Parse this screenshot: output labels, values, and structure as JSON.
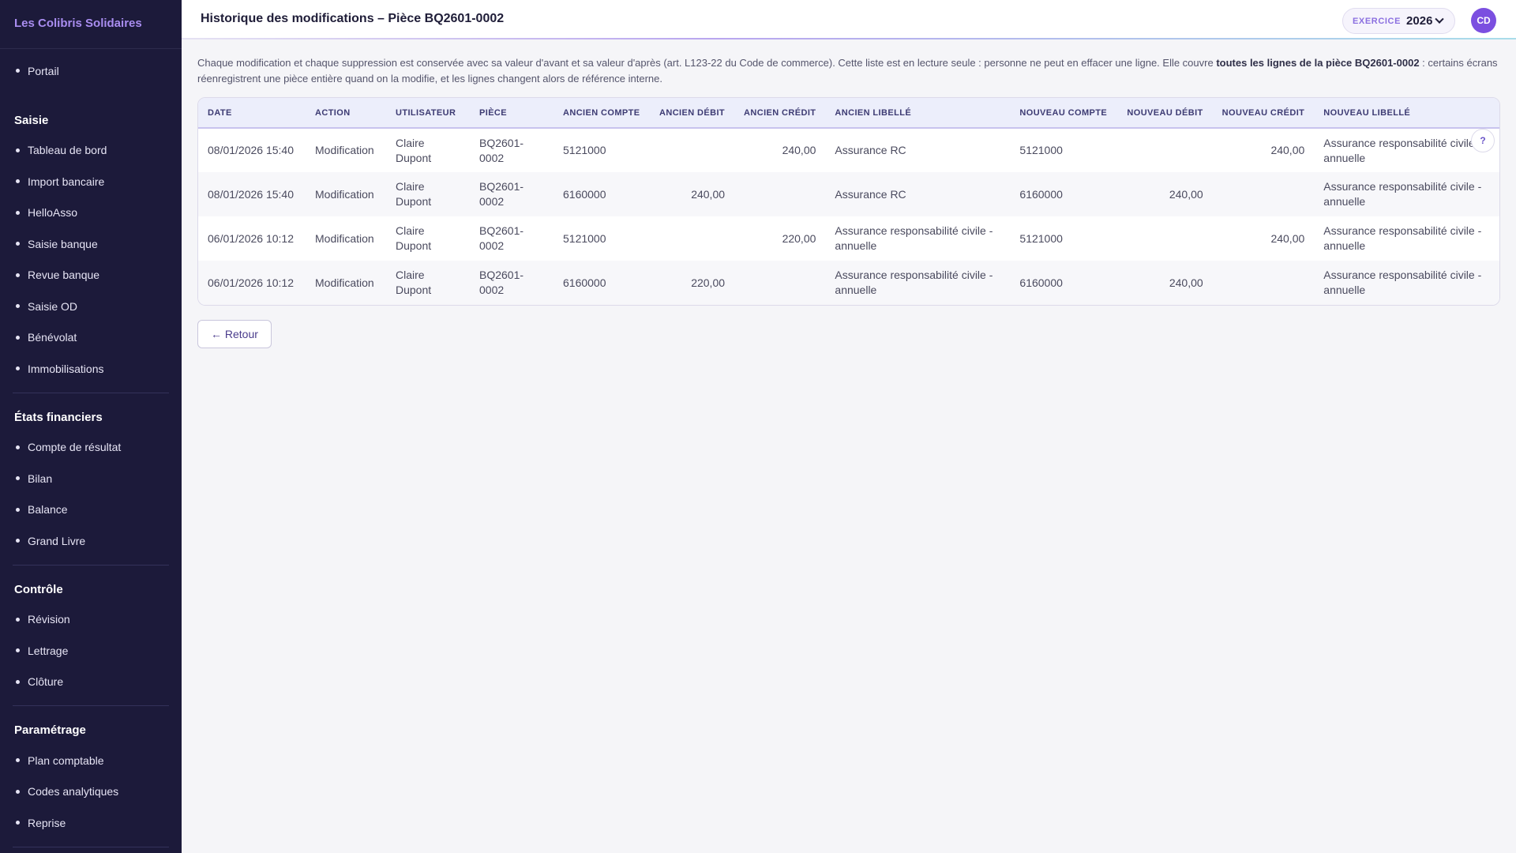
{
  "brand": "Les Colibris Solidaires",
  "nav_top": [
    {
      "label": "Portail"
    }
  ],
  "nav_sections": [
    {
      "title": "Saisie",
      "items": [
        "Tableau de bord",
        "Import bancaire",
        "HelloAsso",
        "Saisie banque",
        "Revue banque",
        "Saisie OD",
        "Bénévolat",
        "Immobilisations"
      ]
    },
    {
      "title": "États financiers",
      "items": [
        "Compte de résultat",
        "Bilan",
        "Balance",
        "Grand Livre"
      ]
    },
    {
      "title": "Contrôle",
      "items": [
        "Révision",
        "Lettrage",
        "Clôture"
      ]
    },
    {
      "title": "Paramétrage",
      "items": [
        "Plan comptable",
        "Codes analytiques",
        "Reprise"
      ]
    }
  ],
  "header": {
    "title": "Historique des modifications – Pièce BQ2601-0002",
    "exercice_label": "EXERCICE",
    "exercice_year": "2026",
    "avatar_initials": "CD"
  },
  "intro": {
    "text": "Chaque modification et chaque suppression est conservée avec sa valeur d'avant et sa valeur d'après (art. L123-22 du Code de commerce). Cette liste est en lecture seule : personne ne peut en effacer une ligne. Elle couvre ",
    "bold": "toutes les lignes de la pièce BQ2601-0002",
    "text_after": " : certains écrans réenregistrent une pièce entière quand on la modifie, et les lignes changent alors de référence interne."
  },
  "table": {
    "columns": [
      "DATE",
      "ACTION",
      "UTILISATEUR",
      "PIÈCE",
      "ANCIEN COMPTE",
      "ANCIEN DÉBIT",
      "ANCIEN CRÉDIT",
      "ANCIEN LIBELLÉ",
      "NOUVEAU COMPTE",
      "NOUVEAU DÉBIT",
      "NOUVEAU CRÉDIT",
      "NOUVEAU LIBELLÉ"
    ],
    "rows": [
      [
        "08/01/2026 15:40",
        "Modification",
        "Claire Dupont",
        "BQ2601-0002",
        "5121000",
        "",
        "240,00",
        "Assurance RC",
        "5121000",
        "",
        "240,00",
        "Assurance responsabilité civile - annuelle"
      ],
      [
        "08/01/2026 15:40",
        "Modification",
        "Claire Dupont",
        "BQ2601-0002",
        "6160000",
        "240,00",
        "",
        "Assurance RC",
        "6160000",
        "240,00",
        "",
        "Assurance responsabilité civile - annuelle"
      ],
      [
        "06/01/2026 10:12",
        "Modification",
        "Claire Dupont",
        "BQ2601-0002",
        "5121000",
        "",
        "220,00",
        "Assurance responsabilité civile - annuelle",
        "5121000",
        "",
        "240,00",
        "Assurance responsabilité civile - annuelle"
      ],
      [
        "06/01/2026 10:12",
        "Modification",
        "Claire Dupont",
        "BQ2601-0002",
        "6160000",
        "220,00",
        "",
        "Assurance responsabilité civile - annuelle",
        "6160000",
        "240,00",
        "",
        "Assurance responsabilité civile - annuelle"
      ]
    ],
    "help_label": "?"
  },
  "back_button": "← Retour"
}
